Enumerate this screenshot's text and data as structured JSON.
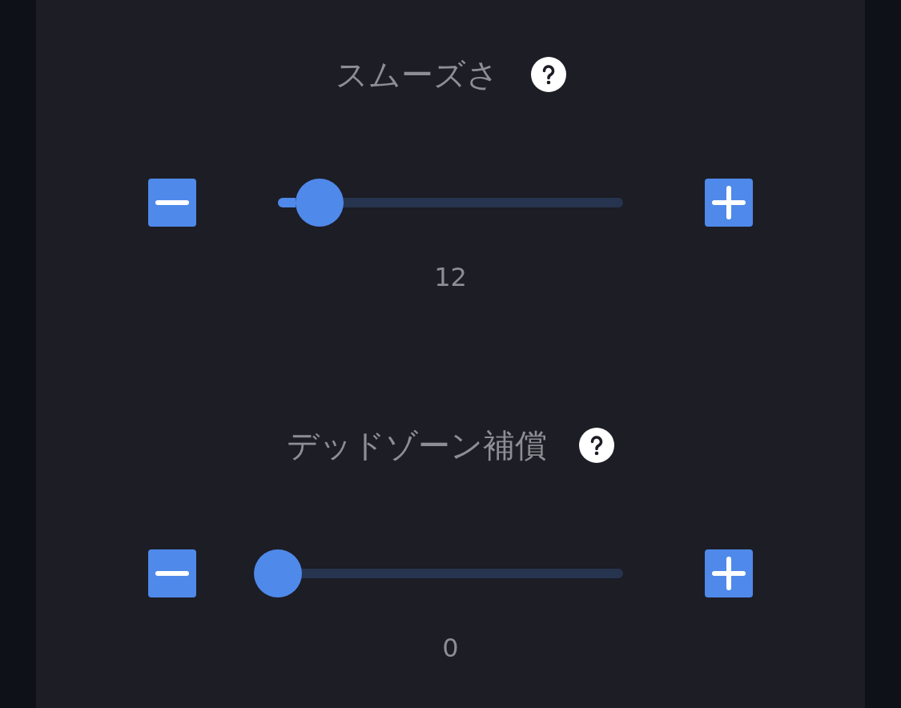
{
  "settings": [
    {
      "title": "スムーズさ",
      "level": 0.12,
      "value": "12"
    },
    {
      "title": "デッドゾーン補償",
      "level": 0,
      "value": "0"
    }
  ]
}
